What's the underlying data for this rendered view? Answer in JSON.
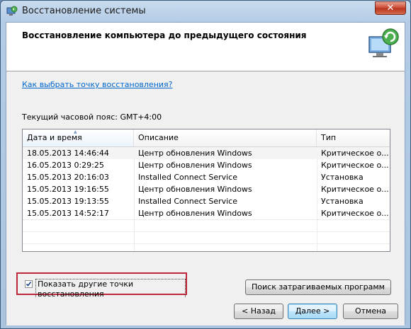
{
  "window": {
    "title": "Восстановление системы",
    "close_glyph": "✕"
  },
  "header": {
    "title": "Восстановление компьютера до предыдущего состояния",
    "icon": "system-restore-icon"
  },
  "link": {
    "text": "Как выбрать точку восстановления?"
  },
  "timezone": {
    "text": "Текущий часовой пояс: GMT+4:00"
  },
  "table": {
    "columns": [
      "Дата и время",
      "Описание",
      "Тип"
    ],
    "sort_indicator": "▲",
    "rows": [
      {
        "date": "18.05.2013 14:46:44",
        "description": "Центр обновления Windows",
        "type": "Критическое о..."
      },
      {
        "date": "16.05.2013 0:29:25",
        "description": "Центр обновления Windows",
        "type": "Критическое о..."
      },
      {
        "date": "15.05.2013 20:16:03",
        "description": "Installed Connect Service",
        "type": "Установка"
      },
      {
        "date": "15.05.2013 19:16:55",
        "description": "Центр обновления Windows",
        "type": "Критическое о..."
      },
      {
        "date": "15.05.2013 19:13:55",
        "description": "Installed Connect Service",
        "type": "Установка"
      },
      {
        "date": "15.05.2013 14:52:17",
        "description": "Центр обновления Windows",
        "type": "Критическое о..."
      }
    ]
  },
  "checkbox": {
    "label": "Показать другие точки восстановления",
    "checked": true
  },
  "buttons": {
    "affected_programs": "Поиск затрагиваемых программ",
    "back": "< Назад",
    "next": "Далее >",
    "cancel": "Отмена"
  },
  "colors": {
    "highlight_border": "#c0263b",
    "link": "#0066cc",
    "title_bar": "#b4cce6"
  }
}
